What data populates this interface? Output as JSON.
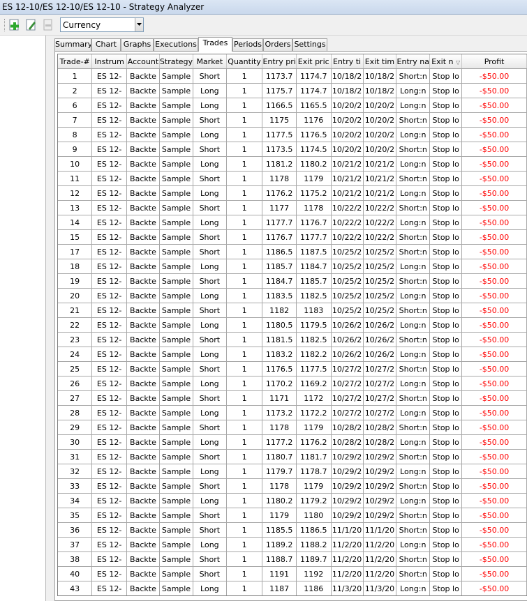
{
  "window": {
    "title": "ES 12-10/ES 12-10/ES 12-10 - Strategy Analyzer"
  },
  "toolbar": {
    "display_combo_value": "Currency",
    "add_icon": "add-icon",
    "edit_icon": "edit-icon",
    "remove_icon": "remove-icon"
  },
  "tabs": [
    "Summary",
    "Chart",
    "Graphs",
    "Executions",
    "Trades",
    "Periods",
    "Orders",
    "Settings"
  ],
  "active_tab": "Trades",
  "columns": [
    "Trade-#",
    "Instrum",
    "Account",
    "Strategy",
    "Market",
    "Quantity",
    "Entry pri",
    "Exit pric",
    "Entry ti",
    "Exit tim",
    "Entry na",
    "Exit n",
    "Profit"
  ],
  "sort_column_indicator": "▽",
  "colors": {
    "profit_negative": "#ff0000",
    "title_bar": "#c9d8ec"
  },
  "rows": [
    [
      "1",
      "ES 12-",
      "Backte",
      "Sample",
      "Short",
      "1",
      "1173.7",
      "1174.7",
      "10/18/2",
      "10/18/2",
      "Short:n",
      "Stop lo",
      "-$50.00"
    ],
    [
      "2",
      "ES 12-",
      "Backte",
      "Sample",
      "Long",
      "1",
      "1175.7",
      "1174.7",
      "10/18/2",
      "10/18/2",
      "Long:n",
      "Stop lo",
      "-$50.00"
    ],
    [
      "6",
      "ES 12-",
      "Backte",
      "Sample",
      "Long",
      "1",
      "1166.5",
      "1165.5",
      "10/20/2",
      "10/20/2",
      "Long:n",
      "Stop lo",
      "-$50.00"
    ],
    [
      "7",
      "ES 12-",
      "Backte",
      "Sample",
      "Short",
      "1",
      "1175",
      "1176",
      "10/20/2",
      "10/20/2",
      "Short:n",
      "Stop lo",
      "-$50.00"
    ],
    [
      "8",
      "ES 12-",
      "Backte",
      "Sample",
      "Long",
      "1",
      "1177.5",
      "1176.5",
      "10/20/2",
      "10/20/2",
      "Long:n",
      "Stop lo",
      "-$50.00"
    ],
    [
      "9",
      "ES 12-",
      "Backte",
      "Sample",
      "Short",
      "1",
      "1173.5",
      "1174.5",
      "10/20/2",
      "10/20/2",
      "Short:n",
      "Stop lo",
      "-$50.00"
    ],
    [
      "10",
      "ES 12-",
      "Backte",
      "Sample",
      "Long",
      "1",
      "1181.2",
      "1180.2",
      "10/21/2",
      "10/21/2",
      "Long:n",
      "Stop lo",
      "-$50.00"
    ],
    [
      "11",
      "ES 12-",
      "Backte",
      "Sample",
      "Short",
      "1",
      "1178",
      "1179",
      "10/21/2",
      "10/21/2",
      "Short:n",
      "Stop lo",
      "-$50.00"
    ],
    [
      "12",
      "ES 12-",
      "Backte",
      "Sample",
      "Long",
      "1",
      "1176.2",
      "1175.2",
      "10/21/2",
      "10/21/2",
      "Long:n",
      "Stop lo",
      "-$50.00"
    ],
    [
      "13",
      "ES 12-",
      "Backte",
      "Sample",
      "Short",
      "1",
      "1177",
      "1178",
      "10/22/2",
      "10/22/2",
      "Short:n",
      "Stop lo",
      "-$50.00"
    ],
    [
      "14",
      "ES 12-",
      "Backte",
      "Sample",
      "Long",
      "1",
      "1177.7",
      "1176.7",
      "10/22/2",
      "10/22/2",
      "Long:n",
      "Stop lo",
      "-$50.00"
    ],
    [
      "15",
      "ES 12-",
      "Backte",
      "Sample",
      "Short",
      "1",
      "1176.7",
      "1177.7",
      "10/22/2",
      "10/22/2",
      "Short:n",
      "Stop lo",
      "-$50.00"
    ],
    [
      "17",
      "ES 12-",
      "Backte",
      "Sample",
      "Short",
      "1",
      "1186.5",
      "1187.5",
      "10/25/2",
      "10/25/2",
      "Short:n",
      "Stop lo",
      "-$50.00"
    ],
    [
      "18",
      "ES 12-",
      "Backte",
      "Sample",
      "Long",
      "1",
      "1185.7",
      "1184.7",
      "10/25/2",
      "10/25/2",
      "Long:n",
      "Stop lo",
      "-$50.00"
    ],
    [
      "19",
      "ES 12-",
      "Backte",
      "Sample",
      "Short",
      "1",
      "1184.7",
      "1185.7",
      "10/25/2",
      "10/25/2",
      "Short:n",
      "Stop lo",
      "-$50.00"
    ],
    [
      "20",
      "ES 12-",
      "Backte",
      "Sample",
      "Long",
      "1",
      "1183.5",
      "1182.5",
      "10/25/2",
      "10/25/2",
      "Long:n",
      "Stop lo",
      "-$50.00"
    ],
    [
      "21",
      "ES 12-",
      "Backte",
      "Sample",
      "Short",
      "1",
      "1182",
      "1183",
      "10/25/2",
      "10/25/2",
      "Short:n",
      "Stop lo",
      "-$50.00"
    ],
    [
      "22",
      "ES 12-",
      "Backte",
      "Sample",
      "Long",
      "1",
      "1180.5",
      "1179.5",
      "10/26/2",
      "10/26/2",
      "Long:n",
      "Stop lo",
      "-$50.00"
    ],
    [
      "23",
      "ES 12-",
      "Backte",
      "Sample",
      "Short",
      "1",
      "1181.5",
      "1182.5",
      "10/26/2",
      "10/26/2",
      "Short:n",
      "Stop lo",
      "-$50.00"
    ],
    [
      "24",
      "ES 12-",
      "Backte",
      "Sample",
      "Long",
      "1",
      "1183.2",
      "1182.2",
      "10/26/2",
      "10/26/2",
      "Long:n",
      "Stop lo",
      "-$50.00"
    ],
    [
      "25",
      "ES 12-",
      "Backte",
      "Sample",
      "Short",
      "1",
      "1176.5",
      "1177.5",
      "10/27/2",
      "10/27/2",
      "Short:n",
      "Stop lo",
      "-$50.00"
    ],
    [
      "26",
      "ES 12-",
      "Backte",
      "Sample",
      "Long",
      "1",
      "1170.2",
      "1169.2",
      "10/27/2",
      "10/27/2",
      "Long:n",
      "Stop lo",
      "-$50.00"
    ],
    [
      "27",
      "ES 12-",
      "Backte",
      "Sample",
      "Short",
      "1",
      "1171",
      "1172",
      "10/27/2",
      "10/27/2",
      "Short:n",
      "Stop lo",
      "-$50.00"
    ],
    [
      "28",
      "ES 12-",
      "Backte",
      "Sample",
      "Long",
      "1",
      "1173.2",
      "1172.2",
      "10/27/2",
      "10/27/2",
      "Long:n",
      "Stop lo",
      "-$50.00"
    ],
    [
      "29",
      "ES 12-",
      "Backte",
      "Sample",
      "Short",
      "1",
      "1178",
      "1179",
      "10/28/2",
      "10/28/2",
      "Short:n",
      "Stop lo",
      "-$50.00"
    ],
    [
      "30",
      "ES 12-",
      "Backte",
      "Sample",
      "Long",
      "1",
      "1177.2",
      "1176.2",
      "10/28/2",
      "10/28/2",
      "Long:n",
      "Stop lo",
      "-$50.00"
    ],
    [
      "31",
      "ES 12-",
      "Backte",
      "Sample",
      "Short",
      "1",
      "1180.7",
      "1181.7",
      "10/29/2",
      "10/29/2",
      "Short:n",
      "Stop lo",
      "-$50.00"
    ],
    [
      "32",
      "ES 12-",
      "Backte",
      "Sample",
      "Long",
      "1",
      "1179.7",
      "1178.7",
      "10/29/2",
      "10/29/2",
      "Long:n",
      "Stop lo",
      "-$50.00"
    ],
    [
      "33",
      "ES 12-",
      "Backte",
      "Sample",
      "Short",
      "1",
      "1178",
      "1179",
      "10/29/2",
      "10/29/2",
      "Short:n",
      "Stop lo",
      "-$50.00"
    ],
    [
      "34",
      "ES 12-",
      "Backte",
      "Sample",
      "Long",
      "1",
      "1180.2",
      "1179.2",
      "10/29/2",
      "10/29/2",
      "Long:n",
      "Stop lo",
      "-$50.00"
    ],
    [
      "35",
      "ES 12-",
      "Backte",
      "Sample",
      "Short",
      "1",
      "1179",
      "1180",
      "10/29/2",
      "10/29/2",
      "Short:n",
      "Stop lo",
      "-$50.00"
    ],
    [
      "36",
      "ES 12-",
      "Backte",
      "Sample",
      "Short",
      "1",
      "1185.5",
      "1186.5",
      "11/1/20",
      "11/1/20",
      "Short:n",
      "Stop lo",
      "-$50.00"
    ],
    [
      "37",
      "ES 12-",
      "Backte",
      "Sample",
      "Long",
      "1",
      "1189.2",
      "1188.2",
      "11/2/20",
      "11/2/20",
      "Long:n",
      "Stop lo",
      "-$50.00"
    ],
    [
      "38",
      "ES 12-",
      "Backte",
      "Sample",
      "Short",
      "1",
      "1188.7",
      "1189.7",
      "11/2/20",
      "11/2/20",
      "Short:n",
      "Stop lo",
      "-$50.00"
    ],
    [
      "40",
      "ES 12-",
      "Backte",
      "Sample",
      "Short",
      "1",
      "1191",
      "1192",
      "11/2/20",
      "11/2/20",
      "Short:n",
      "Stop lo",
      "-$50.00"
    ],
    [
      "43",
      "ES 12-",
      "Backte",
      "Sample",
      "Long",
      "1",
      "1187",
      "1186",
      "11/3/20",
      "11/3/20",
      "Long:n",
      "Stop lo",
      "-$50.00"
    ]
  ]
}
